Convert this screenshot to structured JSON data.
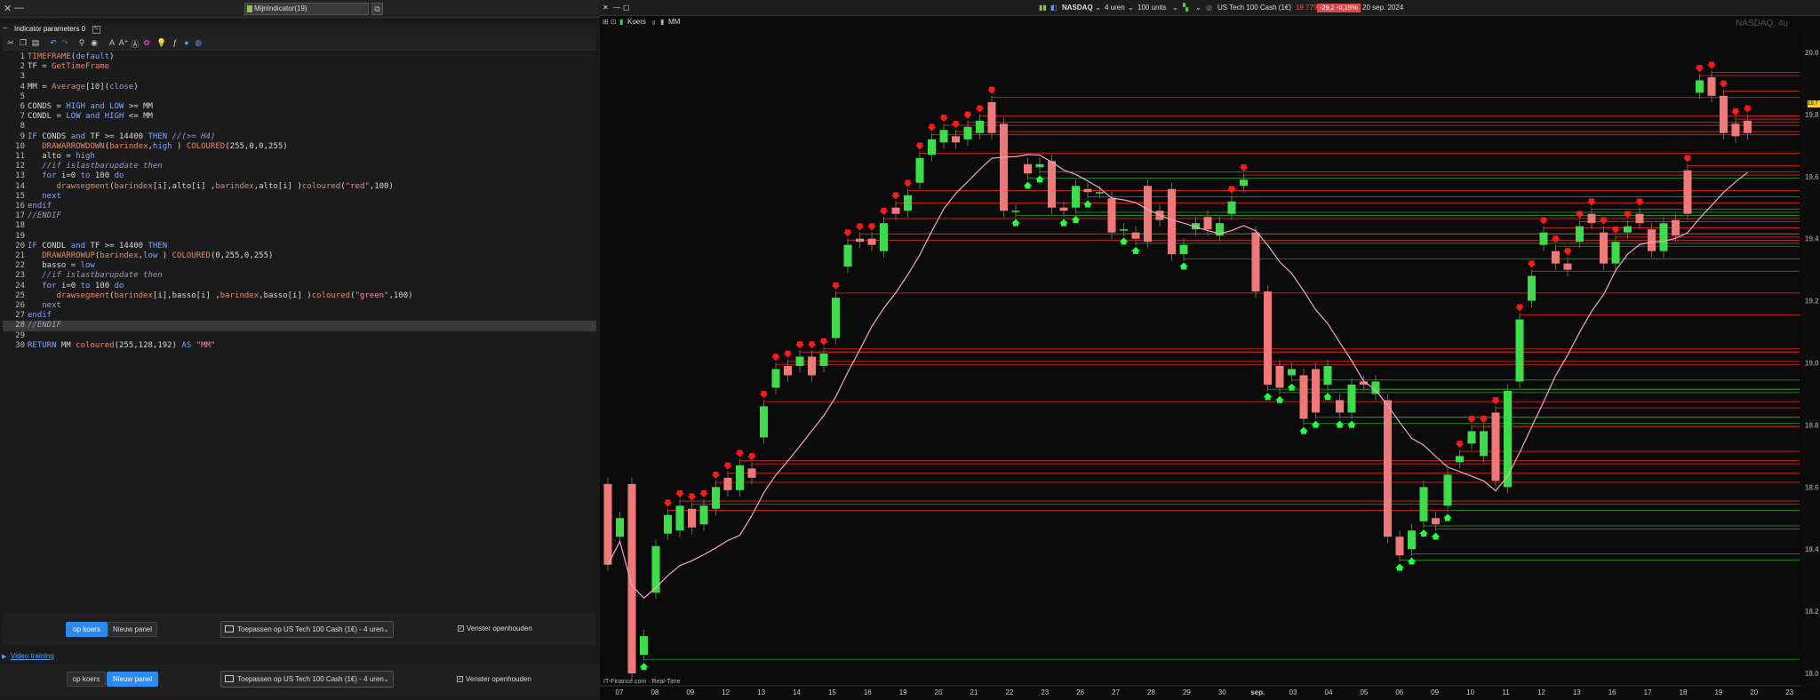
{
  "left_window": {
    "file_tab": "MijnIndicator(19)",
    "panel_title": "Indicator parameters",
    "panel_count": "0"
  },
  "code_lines": [
    {
      "n": "1",
      "t": "TIMEFRAME(default)"
    },
    {
      "n": "2",
      "t": "TF = GetTimeFrame"
    },
    {
      "n": "3",
      "t": ""
    },
    {
      "n": "4",
      "t": "MM = Average[10](close)"
    },
    {
      "n": "5",
      "t": ""
    },
    {
      "n": "6",
      "t": "CONDS = HIGH and LOW >= MM"
    },
    {
      "n": "7",
      "t": "CONDL = LOW and HIGH <= MM"
    },
    {
      "n": "8",
      "t": ""
    },
    {
      "n": "9",
      "t": "IF CONDS and TF >= 14400 THEN //(>= H4)"
    },
    {
      "n": "10",
      "t": "   DRAWARROWDOWN(barindex,high ) COLOURED(255,0,0,255)"
    },
    {
      "n": "11",
      "t": "   alto = high"
    },
    {
      "n": "12",
      "t": "   //if islastbarupdate then"
    },
    {
      "n": "13",
      "t": "   for i=0 to 100 do"
    },
    {
      "n": "14",
      "t": "      drawsegment(barindex[i],alto[i] ,barindex,alto[i] )coloured(\"red\",100)"
    },
    {
      "n": "15",
      "t": "   next"
    },
    {
      "n": "16",
      "t": "endif"
    },
    {
      "n": "17",
      "t": "//ENDIF"
    },
    {
      "n": "18",
      "t": ""
    },
    {
      "n": "19",
      "t": ""
    },
    {
      "n": "20",
      "t": "IF CONDL and TF >= 14400 THEN"
    },
    {
      "n": "21",
      "t": "   DRAWARROWUP(barindex,low ) COLOURED(0,255,0,255)"
    },
    {
      "n": "22",
      "t": "   basso = low"
    },
    {
      "n": "23",
      "t": "   //if islastbarupdate then"
    },
    {
      "n": "24",
      "t": "   for i=0 to 100 do"
    },
    {
      "n": "25",
      "t": "      drawsegment(barindex[i],basso[i] ,barindex,basso[i] )coloured(\"green\",100)"
    },
    {
      "n": "26",
      "t": "   next"
    },
    {
      "n": "27",
      "t": "endif"
    },
    {
      "n": "28",
      "t": "//ENDIF"
    },
    {
      "n": "29",
      "t": ""
    },
    {
      "n": "30",
      "t": "RETURN MM coloured(255,128,192) AS \"MM\""
    }
  ],
  "bottom1": {
    "op_koers": "op koers",
    "nieuw_panel": "Nieuw panel",
    "apply": "Toepassen op US Tech 100 Cash (1€) - 4 uren",
    "venster": "Venster openhouden",
    "active": "op_koers"
  },
  "bottom2": {
    "op_koers": "op koers",
    "nieuw_panel": "Nieuw panel",
    "apply": "Toepassen op US Tech 100 Cash (1€) - 4 uren",
    "venster": "Venster openhouden",
    "active": "nieuw_panel"
  },
  "video_link": "Video training",
  "chart_header": {
    "symbol": "NASDAQ",
    "timeframe": "4 uren",
    "units": "100 units",
    "instrument": "US Tech 100 Cash (1€)",
    "price": "19.779,3",
    "change": "-29,2",
    "change_pct": "-0,15%",
    "date": "20 sep. 2024"
  },
  "chart_sub": {
    "koers": "Koers",
    "mm": "MM"
  },
  "watermark": "NASDAQ, 4u",
  "footer": "IT-Finance.com · Real-Time",
  "price_badge": "19.7",
  "colors": {
    "up": "#3ddc4a",
    "down": "#f07878",
    "ma": "#f0a8c8",
    "hline_red": "#d42020",
    "hline_green": "#1d8a2a",
    "arrow_red": "#ff1a1a",
    "arrow_green": "#22ff44",
    "accent_blue": "#2a8af0"
  },
  "chart_data": {
    "type": "candlestick",
    "y_ticks": [
      "20.0",
      "19.8",
      "19.6",
      "19.4",
      "19.2",
      "19.0",
      "18.8",
      "18.6",
      "18.4",
      "18.2",
      "18.0"
    ],
    "ylim": [
      17.96,
      20.08
    ],
    "x_ticks": [
      "07",
      "08",
      "09",
      "12",
      "13",
      "14",
      "15",
      "16",
      "19",
      "20",
      "21",
      "22",
      "23",
      "26",
      "27",
      "28",
      "29",
      "30",
      "sep.",
      "03",
      "04",
      "05",
      "06",
      "09",
      "10",
      "11",
      "12",
      "13",
      "16",
      "17",
      "18",
      "19",
      "20",
      "23"
    ],
    "candles": [
      [
        18.61,
        18.35
      ],
      [
        18.44,
        18.5
      ],
      [
        18.61,
        18.0
      ],
      [
        18.06,
        18.12
      ],
      [
        18.26,
        18.41
      ],
      [
        18.45,
        18.51
      ],
      [
        18.46,
        18.54
      ],
      [
        18.53,
        18.47
      ],
      [
        18.48,
        18.54
      ],
      [
        18.53,
        18.6
      ],
      [
        18.63,
        18.59
      ],
      [
        18.59,
        18.67
      ],
      [
        18.66,
        18.63
      ],
      [
        18.76,
        18.86
      ],
      [
        18.92,
        18.98
      ],
      [
        18.99,
        18.96
      ],
      [
        18.99,
        19.02
      ],
      [
        19.02,
        18.96
      ],
      [
        18.99,
        19.03
      ],
      [
        19.08,
        19.21
      ],
      [
        19.31,
        19.38
      ],
      [
        19.4,
        19.39
      ],
      [
        19.4,
        19.38
      ],
      [
        19.36,
        19.45
      ],
      [
        19.5,
        19.48
      ],
      [
        19.49,
        19.54
      ],
      [
        19.58,
        19.66
      ],
      [
        19.67,
        19.72
      ],
      [
        19.71,
        19.75
      ],
      [
        19.73,
        19.71
      ],
      [
        19.72,
        19.76
      ],
      [
        19.74,
        19.78
      ],
      [
        19.84,
        19.74
      ],
      [
        19.77,
        19.49
      ],
      [
        19.49,
        19.49
      ],
      [
        19.64,
        19.61
      ],
      [
        19.63,
        19.64
      ],
      [
        19.65,
        19.5
      ],
      [
        19.5,
        19.49
      ],
      [
        19.5,
        19.57
      ],
      [
        19.56,
        19.55
      ],
      [
        19.55,
        19.55
      ],
      [
        19.53,
        19.42
      ],
      [
        19.43,
        19.43
      ],
      [
        19.42,
        19.4
      ],
      [
        19.57,
        19.39
      ],
      [
        19.49,
        19.46
      ],
      [
        19.56,
        19.35
      ],
      [
        19.35,
        19.38
      ],
      [
        19.43,
        19.45
      ],
      [
        19.47,
        19.43
      ],
      [
        19.41,
        19.45
      ],
      [
        19.48,
        19.52
      ],
      [
        19.57,
        19.59
      ],
      [
        19.42,
        19.23
      ],
      [
        19.23,
        18.93
      ],
      [
        18.99,
        18.92
      ],
      [
        18.96,
        18.98
      ],
      [
        18.96,
        18.82
      ],
      [
        18.98,
        18.84
      ],
      [
        18.93,
        18.99
      ],
      [
        18.88,
        18.84
      ],
      [
        18.84,
        18.93
      ],
      [
        18.94,
        18.93
      ],
      [
        18.9,
        18.94
      ],
      [
        18.88,
        18.44
      ],
      [
        18.44,
        18.38
      ],
      [
        18.4,
        18.46
      ],
      [
        18.49,
        18.6
      ],
      [
        18.5,
        18.48
      ],
      [
        18.54,
        18.64
      ],
      [
        18.68,
        18.7
      ],
      [
        18.74,
        18.78
      ],
      [
        18.7,
        18.78
      ],
      [
        18.84,
        18.62
      ],
      [
        18.6,
        18.91
      ],
      [
        18.94,
        19.14
      ],
      [
        19.2,
        19.28
      ],
      [
        19.38,
        19.42
      ],
      [
        19.36,
        19.32
      ],
      [
        19.32,
        19.3
      ],
      [
        19.39,
        19.44
      ],
      [
        19.48,
        19.45
      ],
      [
        19.42,
        19.32
      ],
      [
        19.32,
        19.39
      ],
      [
        19.42,
        19.44
      ],
      [
        19.48,
        19.45
      ],
      [
        19.43,
        19.36
      ],
      [
        19.36,
        19.45
      ],
      [
        19.46,
        19.41
      ],
      [
        19.62,
        19.48
      ],
      [
        19.87,
        19.91
      ],
      [
        19.92,
        19.86
      ],
      [
        19.86,
        19.74
      ],
      [
        19.77,
        19.73
      ],
      [
        19.78,
        19.74
      ]
    ]
  }
}
